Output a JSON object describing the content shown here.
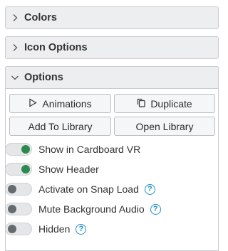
{
  "sections": {
    "colors": {
      "title": "Colors",
      "icon": "chevron-right-icon"
    },
    "icon_options": {
      "title": "Icon Options",
      "icon": "chevron-right-icon"
    },
    "options": {
      "title": "Options",
      "icon": "chevron-down-icon"
    }
  },
  "buttons": {
    "animations": {
      "label": "Animations",
      "icon": "play-icon"
    },
    "duplicate": {
      "label": "Duplicate",
      "icon": "copy-icon"
    },
    "add_to_library": {
      "label": "Add To Library"
    },
    "open_library": {
      "label": "Open Library"
    }
  },
  "toggles": [
    {
      "label": "Show in Cardboard VR",
      "on": true,
      "help": false
    },
    {
      "label": "Show Header",
      "on": true,
      "help": false
    },
    {
      "label": "Activate on Snap Load",
      "on": false,
      "help": true
    },
    {
      "label": "Mute Background Audio",
      "on": false,
      "help": true
    },
    {
      "label": "Hidden",
      "on": false,
      "help": true
    }
  ],
  "help_glyph": "?",
  "colors": {
    "toggle_on": "#2d8a4e",
    "toggle_off": "#666b70",
    "help": "#1f8fc9",
    "header_bg": "#eceef0"
  }
}
